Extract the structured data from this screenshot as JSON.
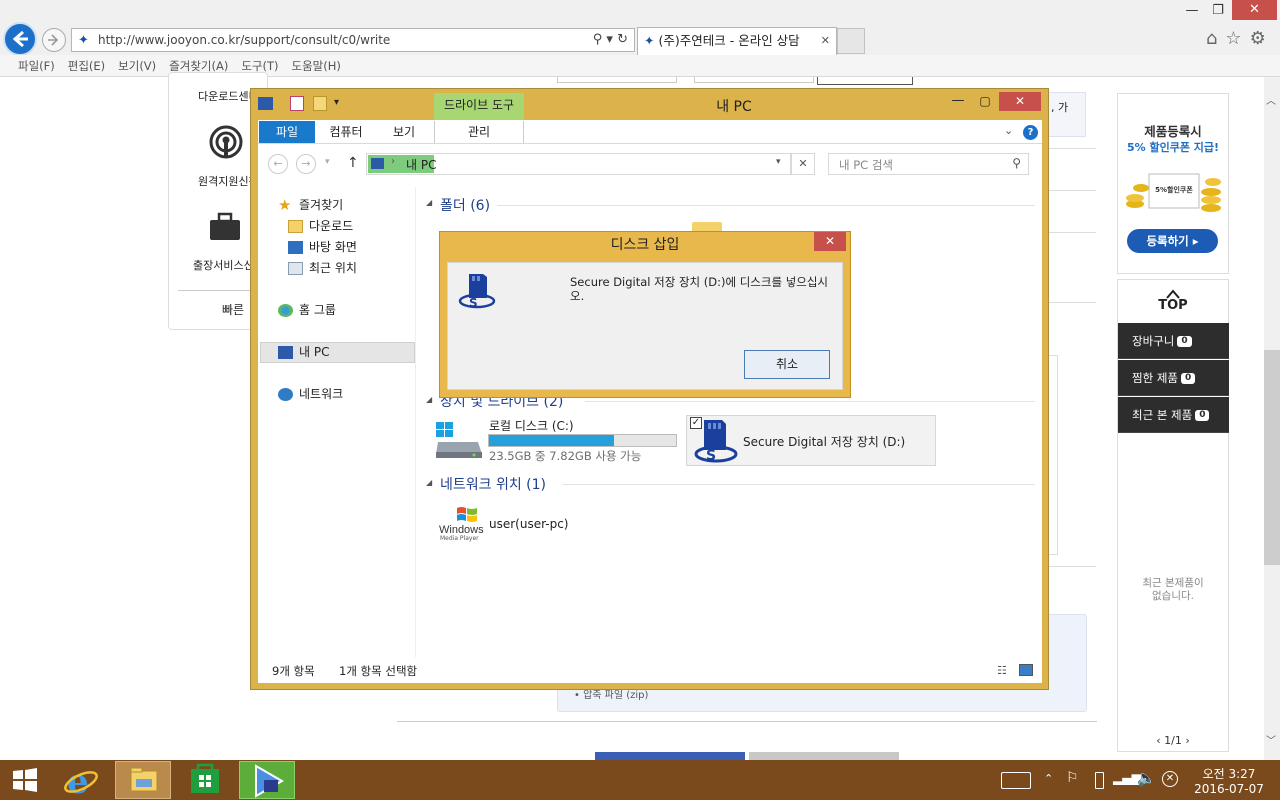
{
  "browser": {
    "url": "http://www.jooyon.co.kr/support/consult/c0/write",
    "tab_title": "(주)주연테크 - 온라인 상담",
    "tab_close": "✕",
    "menu": [
      "파일(F)",
      "편집(E)",
      "보기(V)",
      "즐겨찾기(A)",
      "도구(T)",
      "도움말(H)"
    ]
  },
  "page": {
    "left_nav": [
      "다운로드센터",
      "원격지원신청",
      "출장서비스신청",
      "빠른"
    ],
    "right_snippet": ", 가",
    "promo": {
      "title": "제품등록시",
      "subtitle": "5% 할인쿠폰 지급!",
      "coupon_label": "5%할인쿠폰",
      "button": "등록하기 ▸"
    },
    "top_label": "TOP",
    "side_items": [
      {
        "label": "장바구니",
        "count": "0"
      },
      {
        "label": "찜한 제품",
        "count": "0"
      },
      {
        "label": "최근 본 제품",
        "count": "0"
      }
    ],
    "recent_empty": "최근 본제품이\n없습니다.",
    "pager": "1/1",
    "bottom_snippet": "• 압축 파일 (zip)"
  },
  "explorer": {
    "title": "내 PC",
    "contextual_tab": "드라이브 도구",
    "ribbon_tabs": [
      "파일",
      "컴퓨터",
      "보기",
      "관리"
    ],
    "breadcrumb": "내 PC",
    "search_placeholder": "내 PC 검색",
    "tree": {
      "favorites": "즐겨찾기",
      "downloads": "다운로드",
      "desktop": "바탕 화면",
      "recent": "최근 위치",
      "homegroup": "홈 그룹",
      "this_pc": "내 PC",
      "network": "네트워크"
    },
    "sections": {
      "folders": "폴더 (6)",
      "drives": "장치 및 드라이브 (2)",
      "network": "네트워크 위치 (1)"
    },
    "drive_c": {
      "name": "로컬 디스크 (C:)",
      "info": "23.5GB 중 7.82GB 사용 가능",
      "used_fraction": 0.667
    },
    "drive_d": {
      "name": "Secure Digital 저장 장치 (D:)"
    },
    "network_item": {
      "name": "user(user-pc)",
      "logo_line1": "Windows",
      "logo_line2": "Media Player"
    },
    "status_items": "9개 항목",
    "status_selected": "1개 항목 선택함"
  },
  "dialog": {
    "title": "디스크 삽입",
    "message": "Secure Digital 저장 장치 (D:)에 디스크를 넣으십시오.",
    "cancel": "취소"
  },
  "taskbar": {
    "time": "오전 3:27",
    "date": "2016-07-07"
  },
  "colors": {
    "ie_blue": "#1c70c9",
    "dialog_frame": "#e9b84c",
    "taskbar": "#7a4a1c",
    "ribbon_file": "#1979ca",
    "drive_bar": "#26a0da"
  }
}
